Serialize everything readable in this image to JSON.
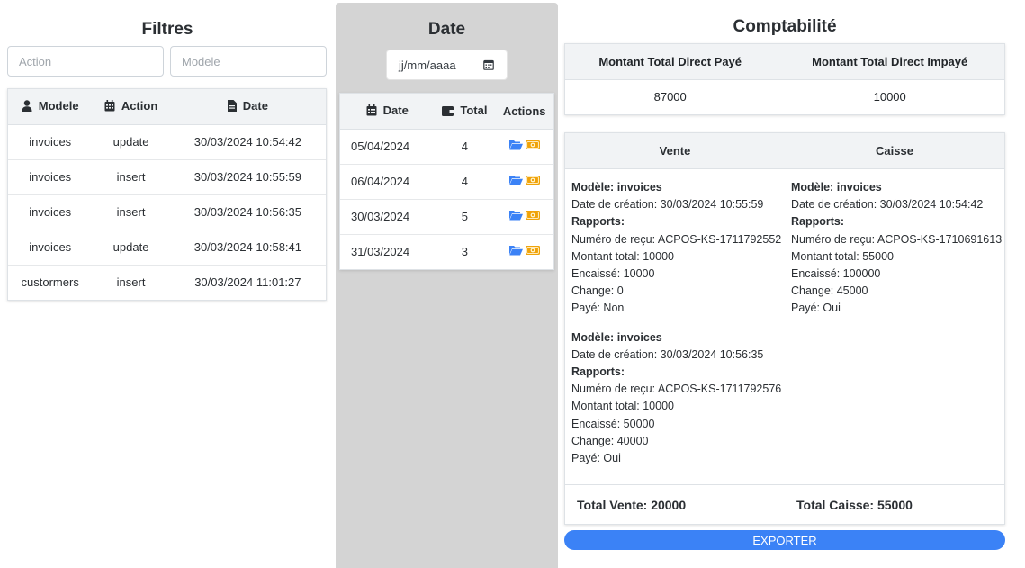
{
  "filters": {
    "title": "Filtres",
    "action_placeholder": "Action",
    "modele_placeholder": "Modele",
    "columns": [
      "Modele",
      "Action",
      "Date"
    ],
    "rows": [
      {
        "modele": "invoices",
        "action": "update",
        "date": "30/03/2024 10:54:42"
      },
      {
        "modele": "invoices",
        "action": "insert",
        "date": "30/03/2024 10:55:59"
      },
      {
        "modele": "invoices",
        "action": "insert",
        "date": "30/03/2024 10:56:35"
      },
      {
        "modele": "invoices",
        "action": "update",
        "date": "30/03/2024 10:58:41"
      },
      {
        "modele": "custormers",
        "action": "insert",
        "date": "30/03/2024 11:01:27"
      }
    ]
  },
  "date_panel": {
    "title": "Date",
    "date_input_placeholder": "jj/mm/aaaa",
    "columns": [
      "Date",
      "Total",
      "Actions"
    ],
    "rows": [
      {
        "date": "05/04/2024",
        "total": "4"
      },
      {
        "date": "06/04/2024",
        "total": "4"
      },
      {
        "date": "30/03/2024",
        "total": "5"
      },
      {
        "date": "31/03/2024",
        "total": "3"
      }
    ]
  },
  "comptabilite": {
    "title": "Comptabilité",
    "summary": {
      "col1_label": "Montant Total Direct Payé",
      "col2_label": "Montant Total Direct Impayé",
      "col1_value": "87000",
      "col2_value": "10000"
    },
    "vente_label": "Vente",
    "caisse_label": "Caisse",
    "vente_entries": [
      {
        "modele": "Modèle: invoices",
        "date": "Date de création: 30/03/2024 10:55:59",
        "rapports": "Rapports:",
        "recu": "Numéro de reçu: ACPOS-KS-1711792552",
        "montant": "Montant total: 10000",
        "encaisse": "Encaissé: 10000",
        "change": "Change: 0",
        "paye": "Payé: Non"
      },
      {
        "modele": "Modèle: invoices",
        "date": "Date de création: 30/03/2024 10:56:35",
        "rapports": "Rapports:",
        "recu": "Numéro de reçu: ACPOS-KS-1711792576",
        "montant": "Montant total: 10000",
        "encaisse": "Encaissé: 50000",
        "change": "Change: 40000",
        "paye": "Payé: Oui"
      }
    ],
    "caisse_entries": [
      {
        "modele": "Modèle: invoices",
        "date": "Date de création: 30/03/2024 10:54:42",
        "rapports": "Rapports:",
        "recu": "Numéro de reçu: ACPOS-KS-1710691613",
        "montant": "Montant total: 55000",
        "encaisse": "Encaissé: 100000",
        "change": "Change: 45000",
        "paye": "Payé: Oui"
      }
    ],
    "total_vente": "Total Vente: 20000",
    "total_caisse": "Total Caisse: 55000",
    "export_label": "EXPORTER"
  },
  "icons": {
    "user": "user-icon",
    "calendar": "calendar-icon",
    "file": "file-icon",
    "wallet": "wallet-icon",
    "folder": "folder-open-icon",
    "money": "money-bill-icon"
  },
  "colors": {
    "accent": "#3b82f6",
    "folder": "#3b82f6",
    "money": "#f0a30a",
    "panel_gray": "#d4d4d4"
  }
}
